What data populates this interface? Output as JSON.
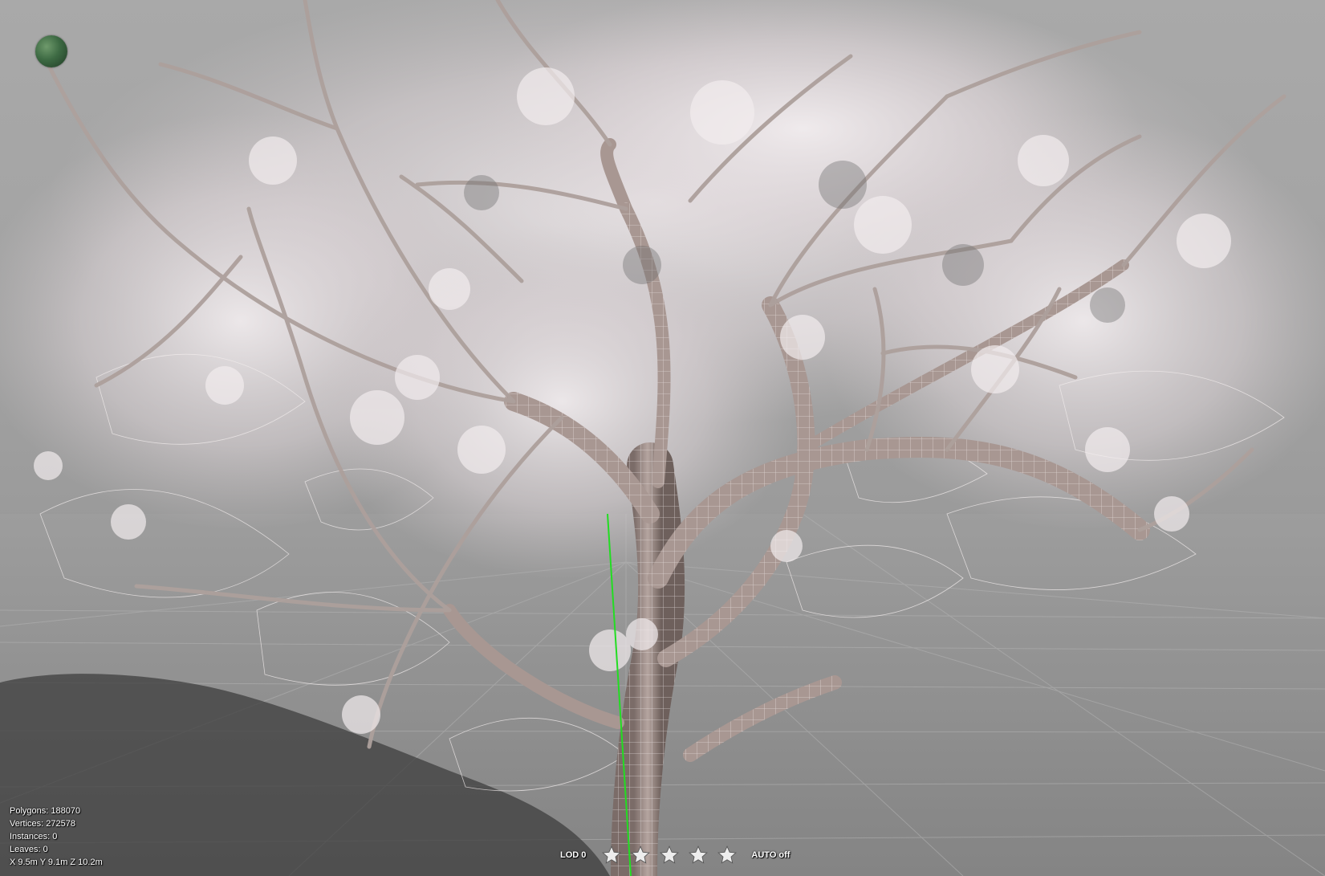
{
  "stats": {
    "polygons": "Polygons: 188070",
    "vertices": "Vertices: 272578",
    "instances": "Instances: 0",
    "leaves": "Leaves: 0",
    "dimensions": "X 9.5m Y 9.1m Z 10.2m"
  },
  "lod": {
    "label": "LOD 0",
    "stars": [
      "star-icon",
      "star-icon",
      "star-icon",
      "star-icon",
      "star-icon"
    ],
    "auto_label": "AUTO off"
  },
  "colors": {
    "sky_top": "#a9a9a9",
    "ground": "#8d8d8d",
    "bark": "#9c8a84",
    "foliage": "#e8dfe2",
    "y_axis": "#22dd22",
    "gizmo": "#3d6a43"
  },
  "icons": {
    "orientation_gizmo": "sphere-icon"
  }
}
